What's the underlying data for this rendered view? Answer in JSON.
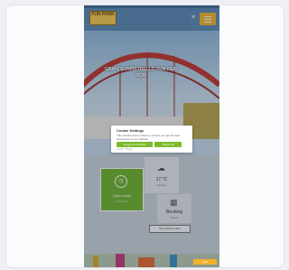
{
  "header": {
    "logo": "FUN PARK",
    "close": "✕"
  },
  "hero": {
    "title": "GRANDE PIPISTRELLO FUN FAIR WOW"
  },
  "cookie": {
    "title": "Cookie Settings",
    "text": "This website uses cookies to ensure you get the best experience on our website.",
    "accept_all": "Accept All Cookies",
    "reject": "Reject All",
    "links": "Imprint · Privacy"
  },
  "tiles": {
    "green": {
      "icon": "clock-icon",
      "label": "Open today",
      "sub": "from 9:00"
    },
    "weather": {
      "icon": "cloud-icon",
      "temp": "17 °C",
      "sub": "weather"
    },
    "book": {
      "icon": "calendar-icon",
      "label": "Booking",
      "sub": "tickets"
    },
    "pill": "Buy tickets online"
  },
  "chat": {
    "label": "Chat"
  }
}
